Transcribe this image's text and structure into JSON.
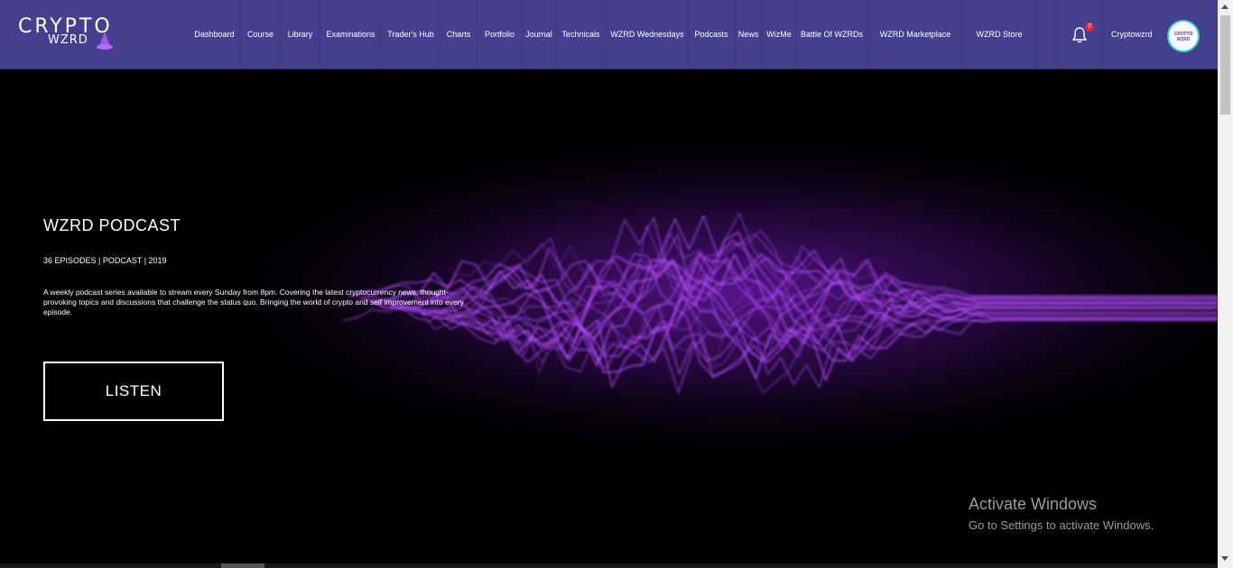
{
  "brand": {
    "line1": "CRYPTO",
    "line2": "WZRD"
  },
  "nav": {
    "items": [
      "Dashboard",
      "Course",
      "Library",
      "Examinations",
      "Trader's Hub",
      "Charts",
      "Portfolio",
      "Journal",
      "Technicals",
      "WZRD Wednesdays",
      "Podcasts",
      "News",
      "WizMe",
      "Battle Of WZRDs",
      "WZRD Marketplace",
      "WZRD Store"
    ],
    "notification_count": "7",
    "username": "Cryptowzrd",
    "avatar_text": "CRYPTO WZRD"
  },
  "hero": {
    "title": "WZRD PODCAST",
    "meta": "36 EPISODES | PODCAST | 2019",
    "description": "A weekly podcast series available to stream every Sunday from 8pm. Covering the latest cryptocurrency news, thought-provoking topics and discussions that challenge the status quo. Bringing the world of crypto and self improvement into every episode.",
    "button_label": "LISTEN"
  },
  "overlay": {
    "activate_title": "Activate Windows",
    "activate_sub": "Go to Settings to activate Windows."
  },
  "colors": {
    "nav_bg": "#453f8f",
    "wave": "#b44dff",
    "badge": "#e0284a"
  }
}
